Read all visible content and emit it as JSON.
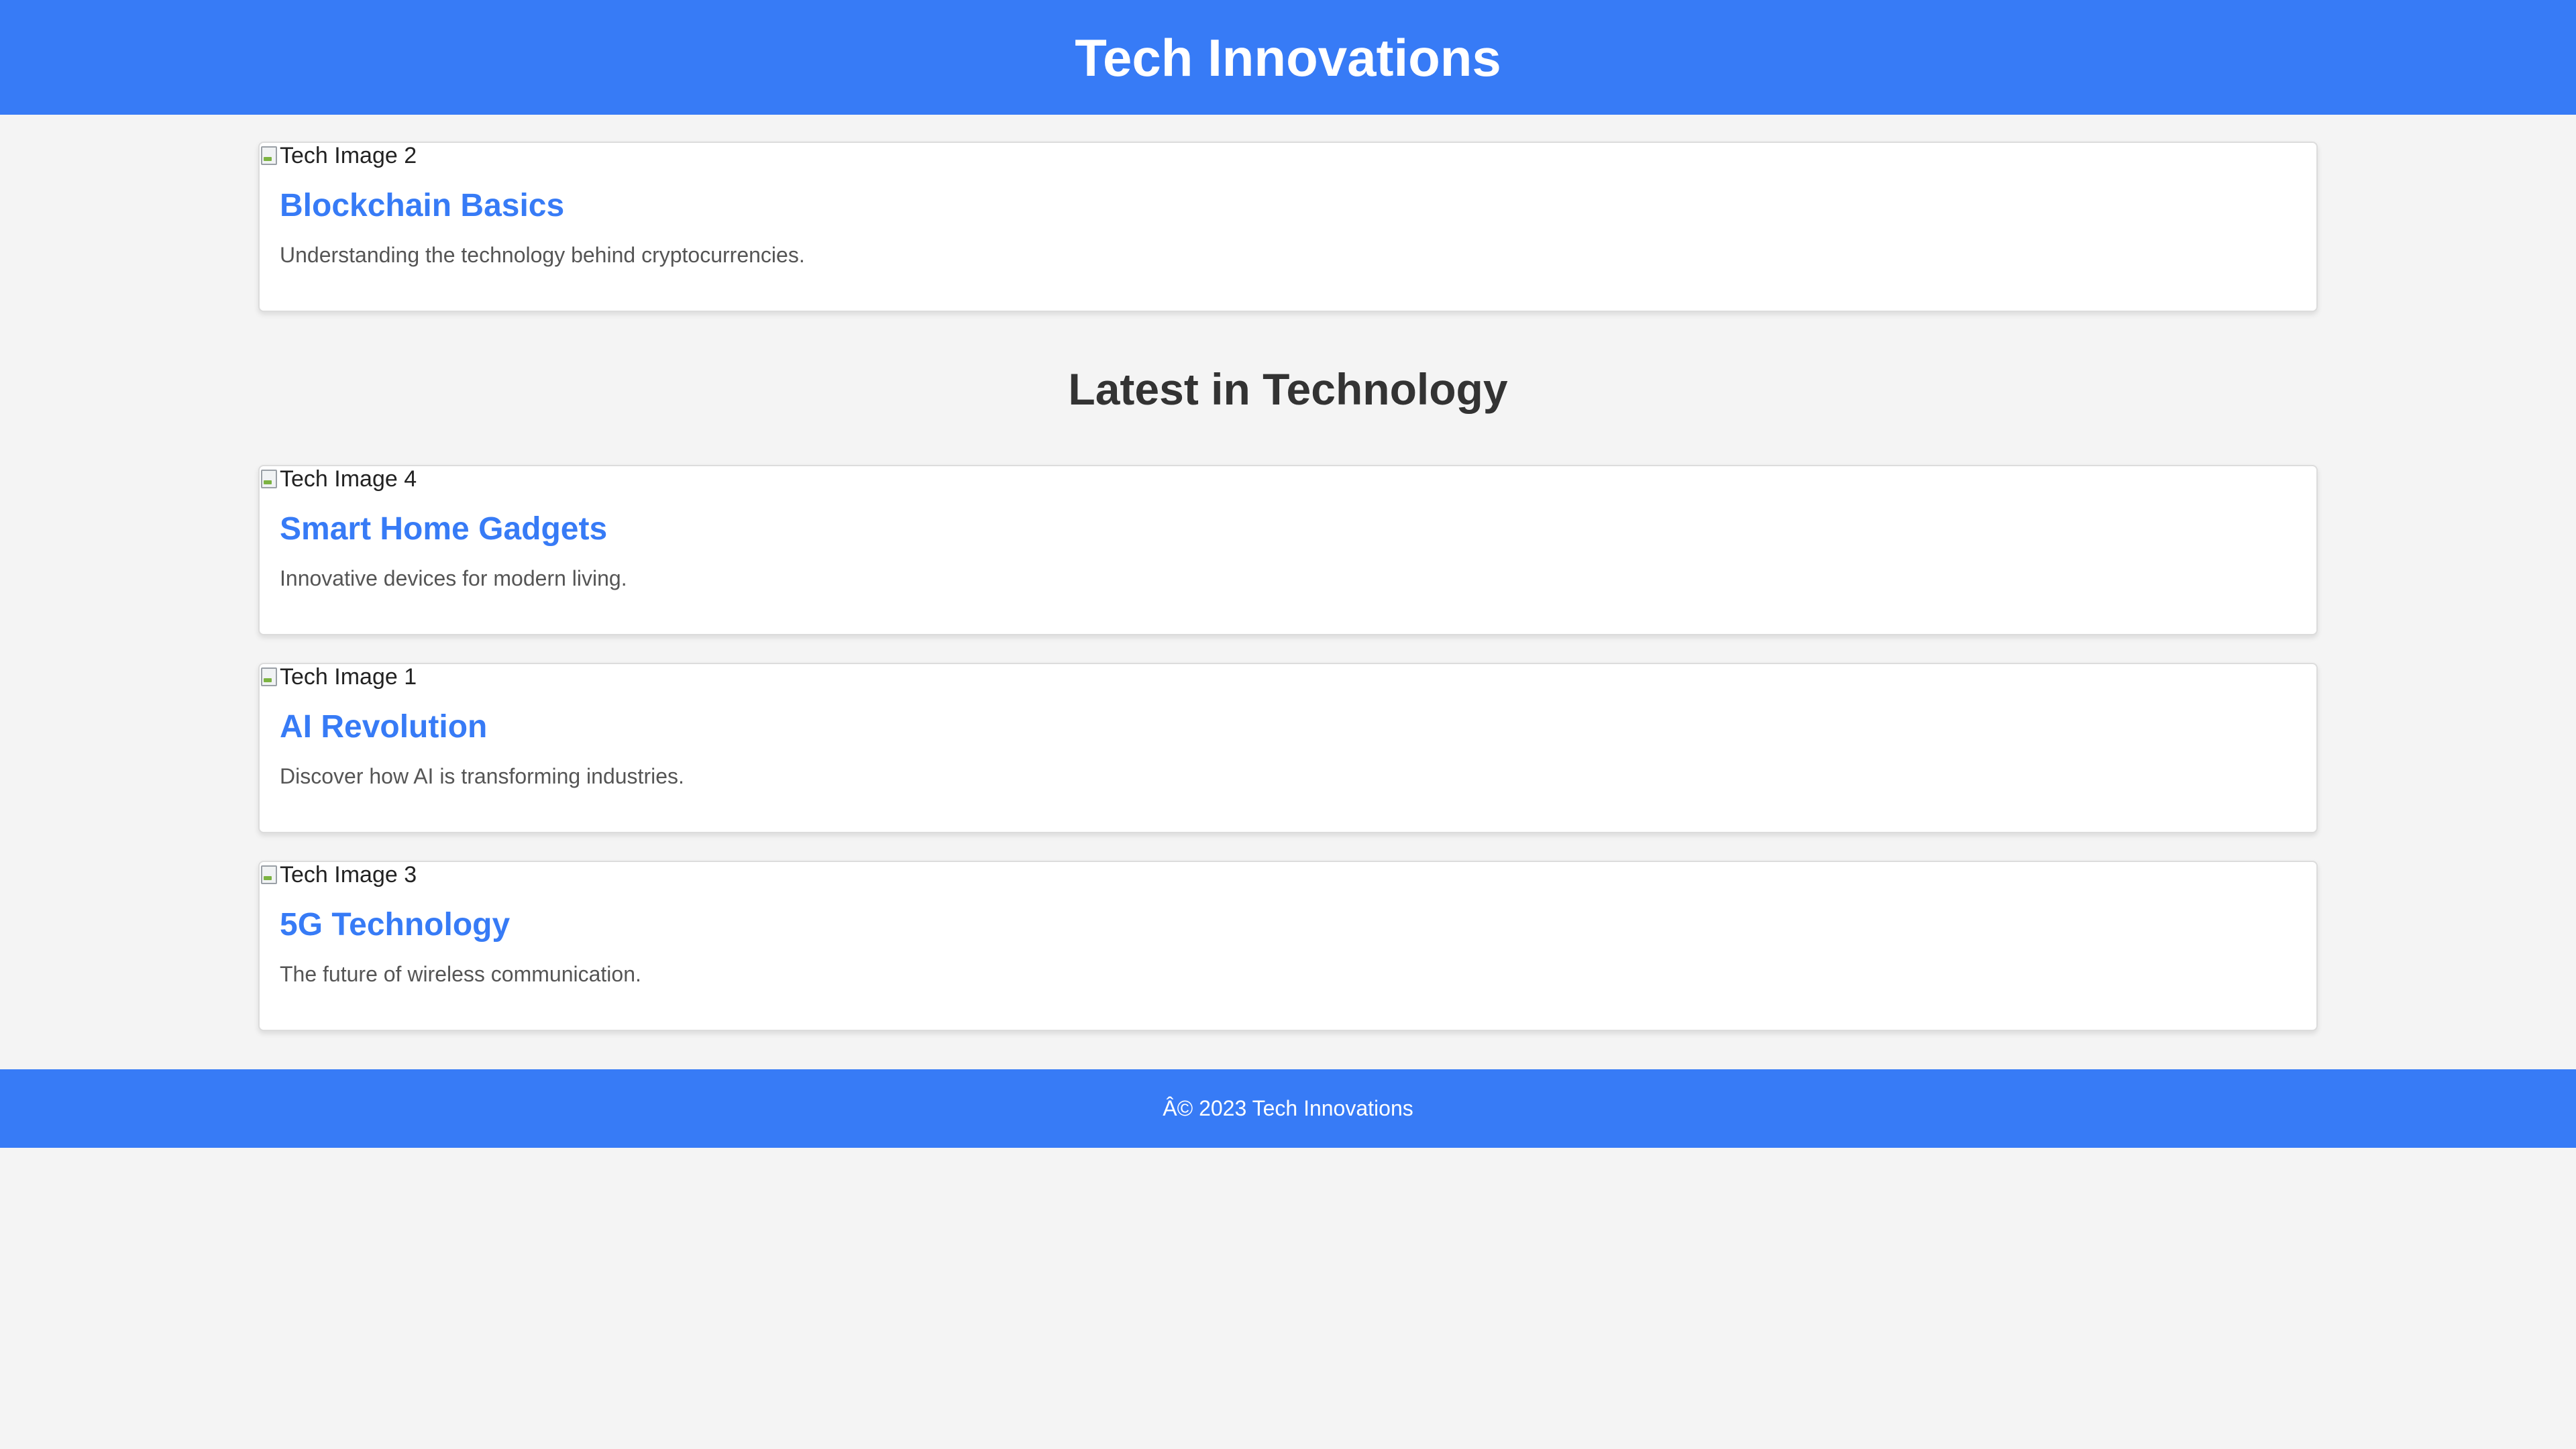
{
  "header": {
    "title": "Tech Innovations"
  },
  "featured": {
    "image_alt": "Tech Image 2",
    "title": "Blockchain Basics",
    "description": "Understanding the technology behind cryptocurrencies."
  },
  "section": {
    "heading": "Latest in Technology"
  },
  "articles": [
    {
      "image_alt": "Tech Image 4",
      "title": "Smart Home Gadgets",
      "description": "Innovative devices for modern living."
    },
    {
      "image_alt": "Tech Image 1",
      "title": "AI Revolution",
      "description": "Discover how AI is transforming industries."
    },
    {
      "image_alt": "Tech Image 3",
      "title": "5G Technology",
      "description": "The future of wireless communication."
    }
  ],
  "footer": {
    "text": "Â© 2023 Tech Innovations"
  },
  "colors": {
    "brand": "#377bf6",
    "background": "#f4f4f4",
    "card": "#ffffff",
    "heading": "#333333",
    "muted_text": "#555555"
  },
  "icons": {
    "image_placeholder": "broken-image-icon"
  }
}
